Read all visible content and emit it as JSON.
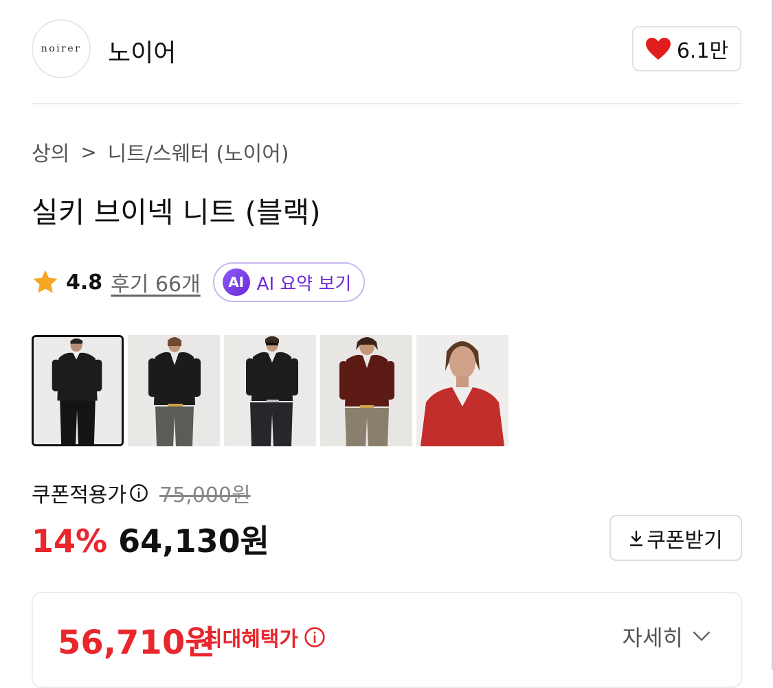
{
  "brand": {
    "logo_text": "noirer",
    "name": "노이어",
    "like_count": "6.1만"
  },
  "breadcrumb": {
    "category": "상의",
    "separator": ">",
    "subcategory": "니트/스웨터 (노이어)"
  },
  "product": {
    "title": "실키 브이넥 니트 (블랙)"
  },
  "rating": {
    "score": "4.8",
    "review_label": "후기 66개",
    "ai_badge": "AI",
    "ai_summary_label": "AI 요약 보기"
  },
  "thumbnails": [
    {
      "name": "black knit with collared shirt",
      "selected": true
    },
    {
      "name": "black knit front"
    },
    {
      "name": "black knit with sunglasses"
    },
    {
      "name": "burgundy knit"
    },
    {
      "name": "red knit close-up"
    }
  ],
  "price": {
    "coupon_label": "쿠폰적용가",
    "original": "75,000원",
    "discount_rate": "14%",
    "sale": "64,130원",
    "coupon_button": "쿠폰받기"
  },
  "benefit": {
    "max_price": "56,710원",
    "label": "최대혜택가",
    "detail_label": "자세히"
  },
  "colors": {
    "accent_red": "#e8262c",
    "ai_purple": "#6d28d9",
    "heart_red": "#e11d1d",
    "star_orange": "#f5a623"
  }
}
